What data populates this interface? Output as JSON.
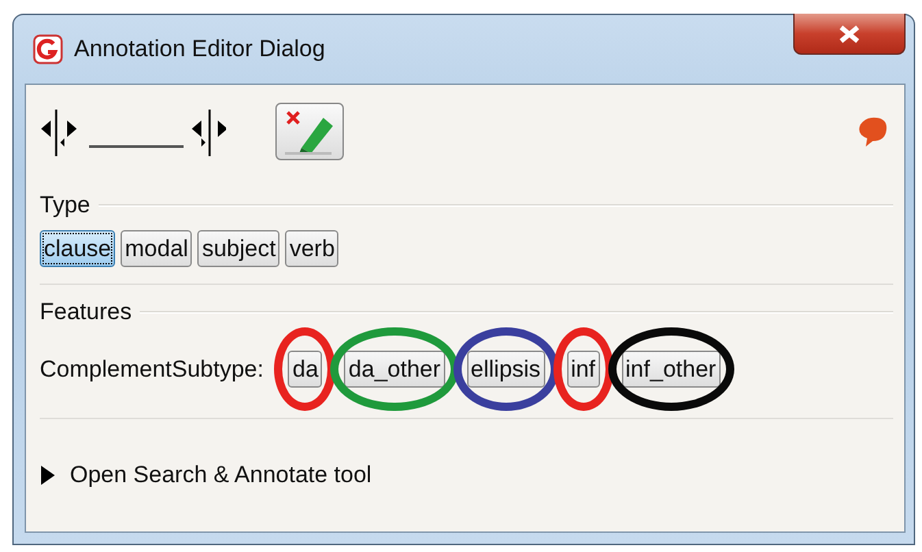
{
  "window": {
    "title": "Annotation Editor Dialog"
  },
  "type": {
    "label": "Type",
    "options": [
      {
        "label": "clause",
        "selected": true
      },
      {
        "label": "modal",
        "selected": false
      },
      {
        "label": "subject",
        "selected": false
      },
      {
        "label": "verb",
        "selected": false
      }
    ]
  },
  "features": {
    "label": "Features",
    "feature_name": "ComplementSubtype:",
    "options": [
      {
        "label": "da",
        "selected": false,
        "color": "#e8231f"
      },
      {
        "label": "da_other",
        "selected": false,
        "color": "#1f9a3c"
      },
      {
        "label": "ellipsis",
        "selected": false,
        "color": "#3a3f9e"
      },
      {
        "label": "inf",
        "selected": false,
        "color": "#e8231f"
      },
      {
        "label": "inf_other",
        "selected": false,
        "color": "#0a0a0a"
      }
    ]
  },
  "footer": {
    "label": "Open Search & Annotate tool",
    "expanded": false
  }
}
